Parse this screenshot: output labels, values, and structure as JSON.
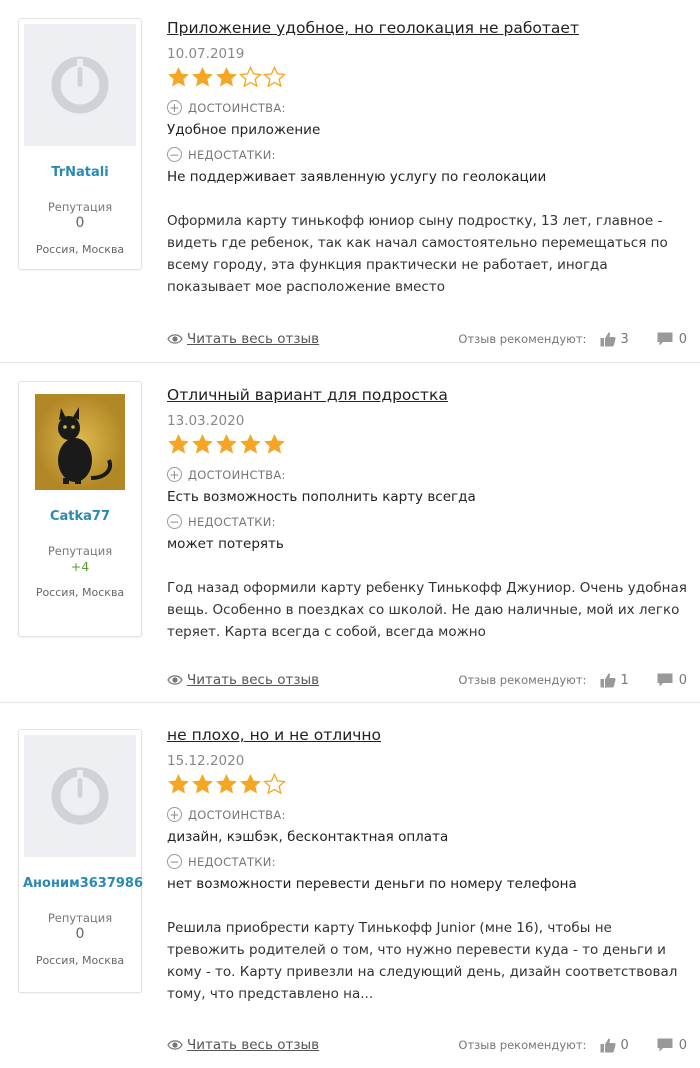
{
  "reviews": [
    {
      "title": "Приложение удобное, но геолокация не работает",
      "date": "10.07.2019",
      "rating": 3,
      "pros_label": "ДОСТОИНСТВА:",
      "pros": "Удобное приложение",
      "cons_label": "НЕДОСТАТКИ:",
      "cons": "Не поддерживает заявленную услугу по геолокации",
      "body": "Оформила карту тинькофф юниор сыну подростку, 13 лет, главное - видеть где ребенок, так как начал самостоятельно перемещаться по всему городу, эта функция практически не работает, иногда показывает мое расположение вместо",
      "read_more": "Читать весь отзыв",
      "recommend_label": "Отзыв рекомендуют:",
      "likes": "3",
      "comments": "0",
      "user": {
        "name": "TrNatali",
        "rep_label": "Репутация",
        "rep": "0",
        "location": "Россия, Москва",
        "avatar": "default-avatar"
      }
    },
    {
      "title": "Отличный вариант для подростка",
      "date": "13.03.2020",
      "rating": 5,
      "pros_label": "ДОСТОИНСТВА:",
      "pros": "Есть возможность пополнить карту всегда",
      "cons_label": "НЕДОСТАТКИ:",
      "cons": "может потерять",
      "body": "Год назад оформили карту ребенку Тинькофф Джуниор. Очень удобная вещь. Особенно в поездках со школой. Не даю наличные, мой их легко теряет. Карта всегда с собой, всегда можно",
      "read_more": "Читать весь отзыв",
      "recommend_label": "Отзыв рекомендуют:",
      "likes": "1",
      "comments": "0",
      "user": {
        "name": "Catka77",
        "rep_label": "Репутация",
        "rep": "+4",
        "location": "Россия, Москва",
        "avatar": "black-cat-photo"
      }
    },
    {
      "title": "не плохо, но и не отлично",
      "date": "15.12.2020",
      "rating": 4,
      "pros_label": "ДОСТОИНСТВА:",
      "pros": "дизайн, кэшбэк, бесконтактная оплата",
      "cons_label": "НЕДОСТАТКИ:",
      "cons": "нет возможности перевести деньги по номеру телефона",
      "body": "Решила приобрести карту Тинькофф Junior (мне 16), чтобы не тревожить родителей о том, что нужно перевести куда - то деньги и кому - то. Карту привезли на следующий день, дизайн соответствовал тому, что представлено на...",
      "read_more": "Читать весь отзыв",
      "recommend_label": "Отзыв рекомендуют:",
      "likes": "0",
      "comments": "0",
      "user": {
        "name": "Аноним3637986",
        "rep_label": "Репутация",
        "rep": "0",
        "location": "Россия, Москва",
        "avatar": "default-avatar"
      }
    }
  ],
  "colors": {
    "star": "#f5a623",
    "username": "#2b8ab1",
    "positive_rep": "#5a9d2e"
  }
}
